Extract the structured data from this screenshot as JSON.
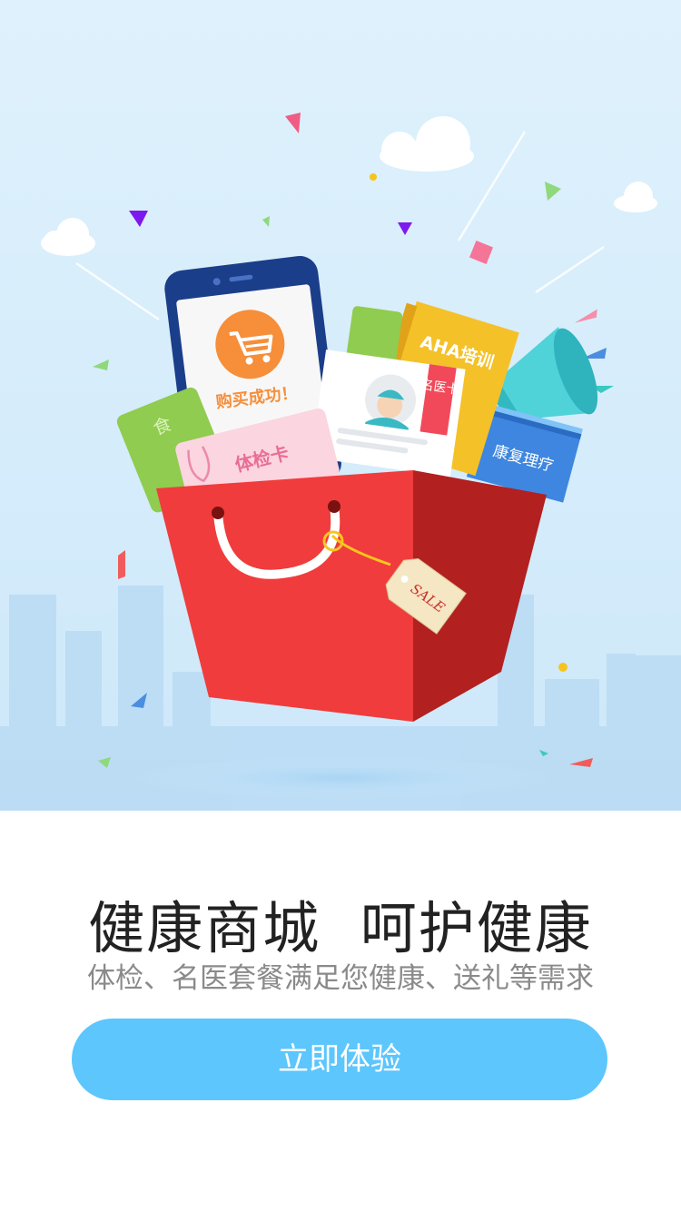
{
  "colors": {
    "sky_top": "#dff1fc",
    "sky_bottom": "#cde8fa",
    "bag_red": "#f03c3c",
    "bag_dark_red": "#b22020",
    "cta_blue": "#5cc6fd",
    "cart_orange": "#f68e3a"
  },
  "illustration": {
    "phone_text": "购买成功！",
    "exam_card": "体检卡",
    "doctor_card": "名医卡",
    "training_book": "AHA培训",
    "rehab_book": "康复理疗",
    "green_card": "食",
    "sale_tag": "SALE"
  },
  "icons": {
    "cart": "shopping-cart-icon",
    "megaphone": "megaphone-icon",
    "doctor": "doctor-avatar-icon",
    "stethoscope": "stethoscope-icon"
  },
  "headline": "健康商城  呵护健康",
  "subtitle": "体检、名医套餐满足您健康、送礼等需求",
  "cta": {
    "label": "立即体验"
  }
}
